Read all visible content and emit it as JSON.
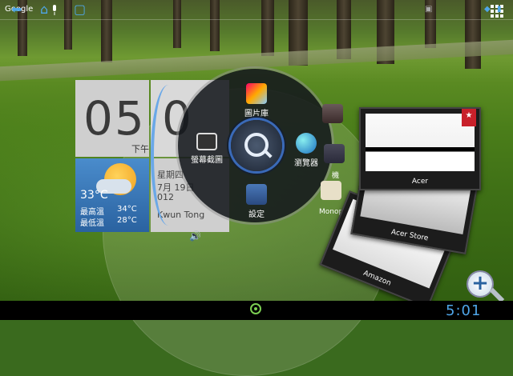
{
  "search": {
    "google_label": "Google"
  },
  "clock": {
    "hour": "05",
    "minute": "0",
    "ampm": "下午"
  },
  "weather": {
    "temp": "33°C",
    "high_label": "最高溫",
    "high": "34°C",
    "low_label": "最低溫",
    "low": "28°C"
  },
  "date": {
    "weekday": "星期四",
    "date": "7月 19日",
    "year": "012",
    "city": "Kwun Tong"
  },
  "radial_menu": {
    "top": {
      "label": "圖片庫",
      "icon": "gallery-icon"
    },
    "left": {
      "label": "螢幕截圖",
      "icon": "screenshot-icon"
    },
    "right": {
      "label": "瀏覽器",
      "icon": "browser-globe-icon"
    },
    "bottom": {
      "label": "設定",
      "icon": "settings-icon"
    },
    "center_icon": "search-icon"
  },
  "side_icons": [
    {
      "label": "機",
      "icon": "camera-icon"
    },
    {
      "label": "Monopo",
      "icon": "monopoly-icon"
    }
  ],
  "cards": [
    {
      "label": "Acer",
      "ribbon": "★"
    },
    {
      "label": "Acer Store"
    },
    {
      "label": "Amazon"
    }
  ],
  "zoom": {
    "symbol": "+"
  },
  "navbar": {
    "back": "⬅",
    "home": "⌂",
    "recent": "▢",
    "time": "5:01"
  },
  "colors": {
    "accent": "#4fa6e8",
    "home_dot": "#7ccf52"
  }
}
